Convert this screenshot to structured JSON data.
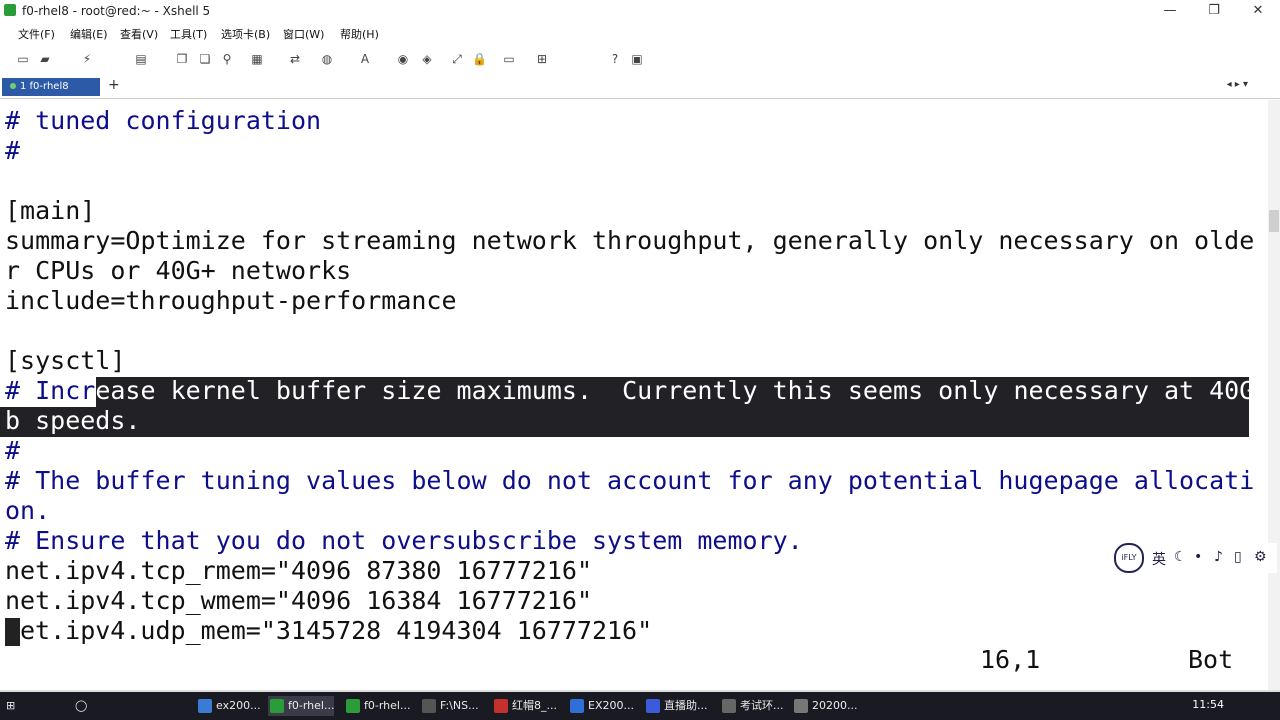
{
  "window": {
    "title": "f0-rhel8 - root@red:~ - Xshell 5",
    "minimize": "—",
    "maximize": "❐",
    "close": "✕"
  },
  "menu": [
    "文件(F)",
    "编辑(E)",
    "查看(V)",
    "工具(T)",
    "选项卡(B)",
    "窗口(W)",
    "帮助(H)"
  ],
  "tabs": {
    "active_label": "1 f0-rhel8",
    "add": "+",
    "menu": "◂ ▸ ▾"
  },
  "terminal": {
    "lines": [
      "# tuned configuration",
      "#",
      "",
      "[main]",
      "summary=Optimize for streaming network throughput, generally only necessary on olde",
      "r CPUs or 40G+ networks",
      "include=throughput-performance",
      "",
      "[sysctl]",
      "# Increase kernel buffer size maximums.  Currently this seems only necessary at 40G",
      "b speeds.",
      "#",
      "# The buffer tuning values below do not account for any potential hugepage allocati",
      "on.",
      "# Ensure that you do not oversubscribe system memory.",
      "net.ipv4.tcp_rmem=\"4096 87380 16777216\"",
      "net.ipv4.tcp_wmem=\"4096 16384 16777216\"",
      "net.ipv4.udp_mem=\"3145728 4194304 16777216\""
    ],
    "line16_rest": "et.ipv4.udp_mem=\"3145728 4194304 16777216\"",
    "sel_line9_pre": "# Incr",
    "sel_line9_hl": "ease kernel buffer size maximums.  Currently this seems only necessary at 40G",
    "status_position": "16,1",
    "status_scroll": "Bot"
  },
  "ime": {
    "logo": "iFLY",
    "lang": "英"
  },
  "taskbar": {
    "items": [
      "ex200...",
      "f0-rhel...",
      "f0-rhel...",
      "F:\\NS...",
      "红帽8_...",
      "EX200...",
      "直播助...",
      "考试环...",
      "20200..."
    ],
    "time": "11:54"
  },
  "colors": {
    "tab_active": "#2d5aa6",
    "selection_bg": "#222226",
    "comment": "#0e0e8a",
    "taskbar": "#1a1a22"
  }
}
